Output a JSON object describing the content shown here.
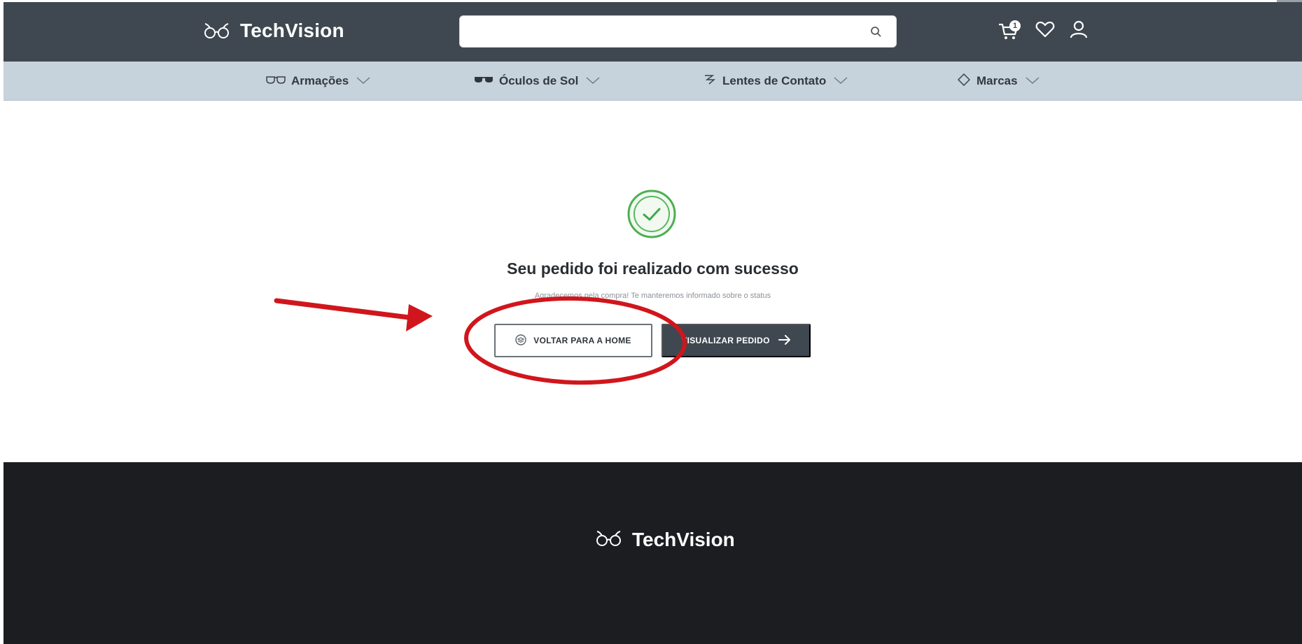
{
  "header": {
    "brand": "TechVision",
    "search": {
      "placeholder": "",
      "value": ""
    },
    "cart_count": "1",
    "icons": [
      "glasses-logo-icon",
      "search-icon",
      "cart-icon",
      "heart-icon",
      "user-icon"
    ]
  },
  "nav": {
    "items": [
      {
        "label": "Armações",
        "icon": "frames-icon"
      },
      {
        "label": "Óculos de Sol",
        "icon": "sunglasses-icon"
      },
      {
        "label": "Lentes de Contato",
        "icon": "contact-lens-icon"
      },
      {
        "label": "Marcas",
        "icon": "tag-icon"
      }
    ]
  },
  "confirmation": {
    "title": "Seu pedido foi realizado com sucesso",
    "subtitle": "Agradecemos pela compra! Te manteremos informado sobre o status",
    "home_button": "VOLTAR PARA A HOME",
    "order_button": "VISUALIZAR PEDIDO"
  },
  "footer": {
    "brand": "TechVision"
  },
  "colors": {
    "header_bg": "#3f4850",
    "nav_bg": "#c6d2dc",
    "footer_bg": "#1c1d21",
    "success": "#3fa84a",
    "annotation": "#d0161c"
  }
}
